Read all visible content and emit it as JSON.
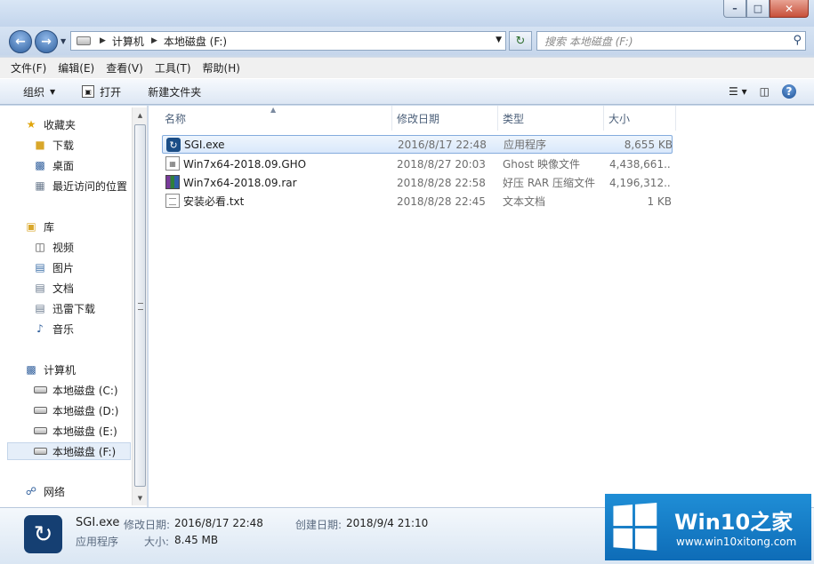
{
  "window": {
    "min_glyph": "–",
    "max_glyph": "□",
    "close_glyph": "✕"
  },
  "address": {
    "crumbs": [
      "计算机",
      "本地磁盘 (F:)"
    ],
    "search_placeholder": "搜索 本地磁盘 (F:)"
  },
  "menu": [
    "文件(F)",
    "编辑(E)",
    "查看(V)",
    "工具(T)",
    "帮助(H)"
  ],
  "commands": {
    "organize": "组织",
    "open": "打开",
    "new_folder": "新建文件夹"
  },
  "nav": {
    "favorites": {
      "header": "收藏夹",
      "items": [
        "下载",
        "桌面",
        "最近访问的位置"
      ]
    },
    "libraries": {
      "header": "库",
      "items": [
        "视频",
        "图片",
        "文档",
        "迅雷下载",
        "音乐"
      ]
    },
    "computer": {
      "header": "计算机",
      "items": [
        "本地磁盘 (C:)",
        "本地磁盘 (D:)",
        "本地磁盘 (E:)",
        "本地磁盘 (F:)"
      ],
      "selected": "本地磁盘 (F:)"
    },
    "network": {
      "header": "网络"
    }
  },
  "columns": {
    "name": "名称",
    "date": "修改日期",
    "type": "类型",
    "size": "大小"
  },
  "files": [
    {
      "name": "SGI.exe",
      "date": "2016/8/17 22:48",
      "type": "应用程序",
      "size": "8,655 KB",
      "icon": "exe-icon",
      "selected": true
    },
    {
      "name": "Win7x64-2018.09.GHO",
      "date": "2018/8/27 20:03",
      "type": "Ghost 映像文件",
      "size": "4,438,661...",
      "icon": "gho-file-icon"
    },
    {
      "name": "Win7x64-2018.09.rar",
      "date": "2018/8/28 22:58",
      "type": "好压 RAR 压缩文件",
      "size": "4,196,312...",
      "icon": "rar-archive-icon"
    },
    {
      "name": "安装必看.txt",
      "date": "2018/8/28 22:45",
      "type": "文本文档",
      "size": "1 KB",
      "icon": "text-file-icon"
    }
  ],
  "details": {
    "name": "SGI.exe",
    "type": "应用程序",
    "modified_label": "修改日期:",
    "modified": "2016/8/17 22:48",
    "created_label": "创建日期:",
    "created": "2018/9/4 21:10",
    "size_label": "大小:",
    "size": "8.45 MB"
  },
  "watermark": {
    "brand": "Win10之家",
    "url": "www.win10xitong.com"
  }
}
